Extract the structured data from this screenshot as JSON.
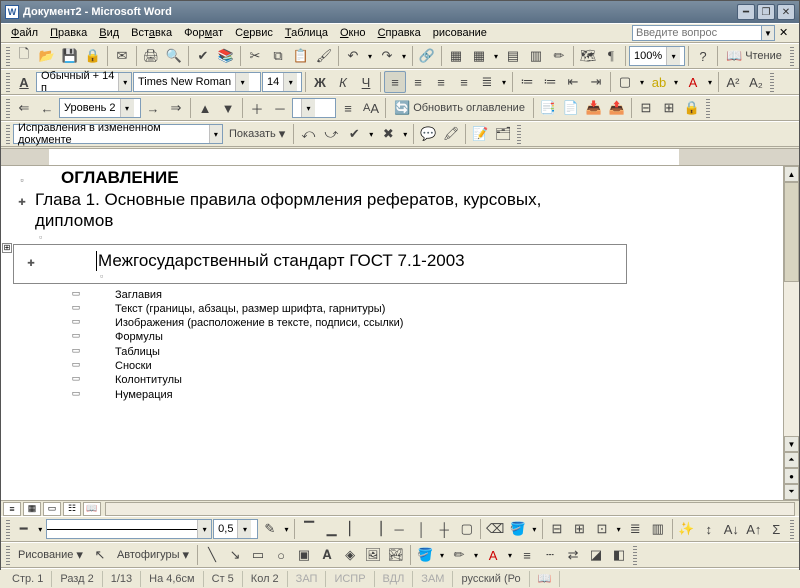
{
  "title": "Документ2 - Microsoft Word",
  "menu": [
    "Файл",
    "Правка",
    "Вид",
    "Вставка",
    "Формат",
    "Сервис",
    "Таблица",
    "Окно",
    "Справка",
    "рисование"
  ],
  "helpbox_placeholder": "Введите вопрос",
  "standard": {
    "zoom": "100%",
    "reading": "Чтение"
  },
  "formatting": {
    "style": "Обычный + 14 п",
    "font": "Times New Roman",
    "size": "14"
  },
  "outline": {
    "level": "Уровень 2",
    "update_toc": "Обновить оглавление"
  },
  "review": {
    "track_label": "Исправления в измененном документе",
    "show_label": "Показать"
  },
  "draw": {
    "line_weight": "0,5",
    "draw_label": "Рисование",
    "autoshapes": "Автофигуры"
  },
  "status": {
    "page": "Стр. 1",
    "section": "Разд 2",
    "pages": "1/13",
    "at": "На 4,6см",
    "line": "Ст 5",
    "col": "Кол 2",
    "rec": "ЗАП",
    "trk": "ИСПР",
    "ext": "ВДЛ",
    "ovr": "ЗАМ",
    "lang": "русский (Ро"
  },
  "document": {
    "heading0": "ОГЛАВЛЕНИЕ",
    "heading1_a": "Глава 1. Основные правила оформления рефератов, курсовых,",
    "heading1_b": "дипломов",
    "toc_entry": "Межгосударственный стандарт ГОСТ 7.1-2003",
    "items": [
      "Заглавия",
      "Текст (границы, абзацы, размер шрифта, гарнитуры)",
      "Изображения (расположение в тексте, подписи, ссылки)",
      "Формулы",
      "Таблицы",
      "Сноски",
      "Колонтитулы",
      "Нумерация"
    ]
  }
}
